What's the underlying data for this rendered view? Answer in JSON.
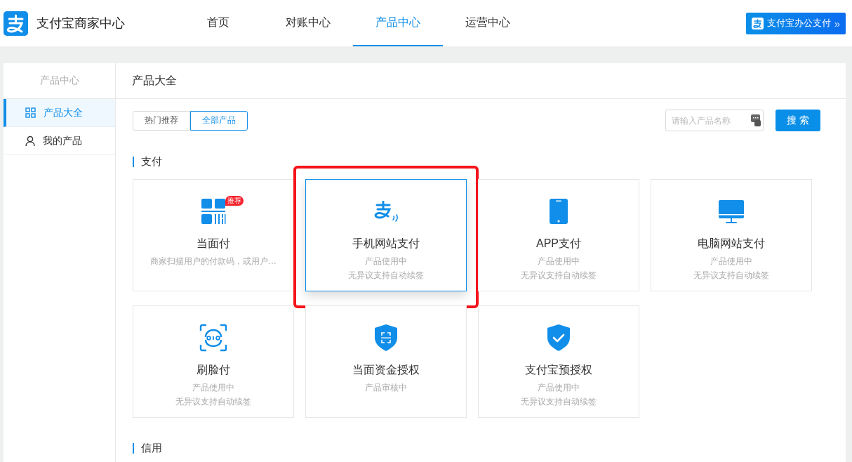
{
  "header": {
    "brand": "支付宝商家中心",
    "nav": [
      {
        "label": "首页",
        "selected": false
      },
      {
        "label": "对账中心",
        "selected": false
      },
      {
        "label": "产品中心",
        "selected": true
      },
      {
        "label": "运营中心",
        "selected": false
      }
    ],
    "promo_button": "支付宝办公支付",
    "promo_arrow": "»"
  },
  "sidebar": {
    "title": "产品中心",
    "items": [
      {
        "label": "产品大全",
        "kind": "grid",
        "selected": true
      },
      {
        "label": "我的产品",
        "kind": "user",
        "selected": false
      }
    ]
  },
  "main": {
    "title": "产品大全",
    "filters": [
      {
        "label": "热门推荐",
        "selected": false
      },
      {
        "label": "全部产品",
        "selected": true
      }
    ],
    "search": {
      "placeholder": "请输入产品名称"
    },
    "search_button": "搜 索",
    "sections": [
      {
        "title": "支付",
        "cards": [
          {
            "kind": "qr",
            "name": "当面付",
            "badge": "推荐",
            "lines": [
              "商家扫描用户的付款码，或用户…"
            ],
            "highlighted": false
          },
          {
            "kind": "alipay",
            "name": "手机网站支付",
            "lines": [
              "产品使用中",
              "无异议支持自动续签"
            ],
            "highlighted": true
          },
          {
            "kind": "phone",
            "name": "APP支付",
            "lines": [
              "产品使用中",
              "无异议支持自动续签"
            ],
            "highlighted": false
          },
          {
            "kind": "monitor",
            "name": "电脑网站支付",
            "lines": [
              "产品使用中",
              "无异议支持自动续签"
            ],
            "highlighted": false
          },
          {
            "kind": "face",
            "name": "刷脸付",
            "lines": [
              "产品使用中",
              "无异议支持自动续签"
            ],
            "highlighted": false
          },
          {
            "kind": "shield-scan",
            "name": "当面资金授权",
            "lines": [
              "产品审核中"
            ],
            "highlighted": false
          },
          {
            "kind": "shield-check",
            "name": "支付宝预授权",
            "lines": [
              "产品使用中",
              "无异议支持自动续签"
            ],
            "highlighted": false
          }
        ]
      },
      {
        "title": "信用"
      }
    ]
  }
}
